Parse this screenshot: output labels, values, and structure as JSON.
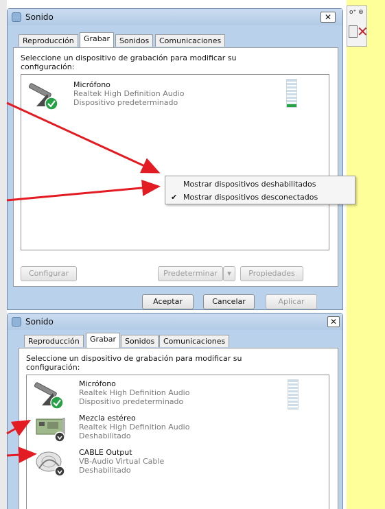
{
  "background": {
    "accent": "#ffff99"
  },
  "side_strip": {
    "text": "o⁺ ⊛"
  },
  "top_window": {
    "title": "Sonido",
    "close_label": "✕",
    "tabs": [
      {
        "label": "Reproducción",
        "active": false
      },
      {
        "label": "Grabar",
        "active": true
      },
      {
        "label": "Sonidos",
        "active": false
      },
      {
        "label": "Comunicaciones",
        "active": false
      }
    ],
    "instruction": "Seleccione un dispositivo de grabación para modificar su configuración:",
    "devices": [
      {
        "name": "Micrófono",
        "driver": "Realtek High Definition Audio",
        "status": "Dispositivo predeterminado",
        "icon": "microphone-icon"
      }
    ],
    "context_menu": [
      {
        "label": "Mostrar dispositivos deshabilitados",
        "checked": false
      },
      {
        "label": "Mostrar dispositivos desconectados",
        "checked": true
      }
    ],
    "buttons": {
      "configure": "Configurar",
      "set_default": "Predeterminar",
      "properties": "Propiedades",
      "ok": "Aceptar",
      "cancel": "Cancelar",
      "apply": "Aplicar"
    }
  },
  "bottom_window": {
    "title": "Sonido",
    "close_label": "✕",
    "tabs": [
      {
        "label": "Reproducción",
        "active": false
      },
      {
        "label": "Grabar",
        "active": true
      },
      {
        "label": "Sonidos",
        "active": false
      },
      {
        "label": "Comunicaciones",
        "active": false
      }
    ],
    "instruction": "Seleccione un dispositivo de grabación para modificar su configuración:",
    "devices": [
      {
        "name": "Micrófono",
        "driver": "Realtek High Definition Audio",
        "status": "Dispositivo predeterminado",
        "icon": "microphone-icon"
      },
      {
        "name": "Mezcla estéreo",
        "driver": "Realtek High Definition Audio",
        "status": "Deshabilitado",
        "icon": "sound-card-icon"
      },
      {
        "name": "CABLE Output",
        "driver": "VB-Audio Virtual Cable",
        "status": "Deshabilitado",
        "icon": "virtual-cable-icon"
      }
    ]
  },
  "colors": {
    "arrow": "#e31b23",
    "title_bar": "#b9d1ea",
    "default_check": "#26a146"
  }
}
